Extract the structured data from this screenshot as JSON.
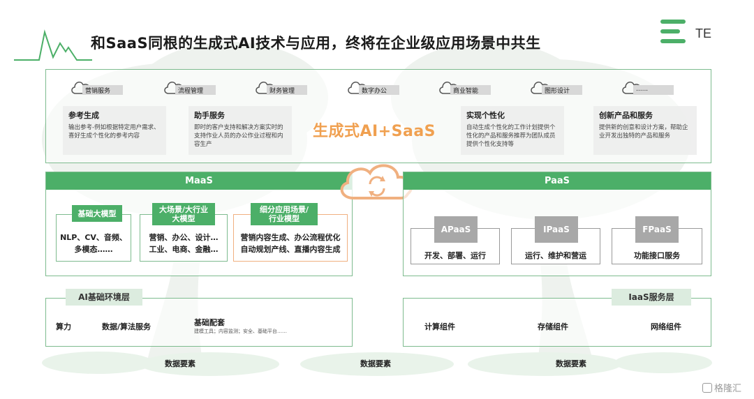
{
  "header": {
    "title": "和SaaS同根的生成式AI技术与应用，终将在企业级应用场景中共生",
    "logo_text": "TE"
  },
  "applications": {
    "categories": [
      "营销服务",
      "流程管理",
      "财务管理",
      "数字办公",
      "商业智能",
      "图形设计",
      "......"
    ],
    "features": [
      {
        "title": "参考生成",
        "desc": "输出参考-例如根据特定用户需求、喜好生成个性化的参考内容"
      },
      {
        "title": "助手服务",
        "desc": "即时的客户支持和解决方案实时的支持作业人员的办公作业过程和内容生产"
      },
      {
        "title": "实现个性化",
        "desc": "自动生成个性化的工作计划提供个性化的产品和服务推荐为团队成员提供个性化支持等"
      },
      {
        "title": "创新产品和服务",
        "desc": "提供新的创意和设计方案，帮助企业开发出独特的产品和服务"
      }
    ],
    "center_label": "生成式AI+SaaS"
  },
  "maas": {
    "title": "MaaS",
    "models": [
      {
        "title": "基础大模型",
        "body": [
          "NLP、CV、音频、",
          "多模态……"
        ]
      },
      {
        "title": "大场景/大行业大模型",
        "body": [
          "营销、办公、设计…",
          "工业、电商、金融…"
        ]
      },
      {
        "title": "细分应用场景/行业模型",
        "body": [
          "营销内容生成、办公流程优化",
          "自动规划产线、直播内容生成"
        ]
      }
    ]
  },
  "paas": {
    "title": "PaaS",
    "items": [
      {
        "title": "APaaS",
        "body": "开发、部署、运行"
      },
      {
        "title": "IPaaS",
        "body": "运行、维护和营运"
      },
      {
        "title": "FPaaS",
        "body": "功能接口服务"
      }
    ]
  },
  "ai_env": {
    "title": "AI基础环境层",
    "items": [
      "算力",
      "数据/算法服务",
      "基础配套"
    ],
    "sub": "建模工具；内容监测；安全、基础平台……"
  },
  "iaas": {
    "title": "IaaS服务层",
    "items": [
      "计算组件",
      "存储组件",
      "网络组件"
    ]
  },
  "ground": {
    "labels": [
      "数据要素",
      "数据要素",
      "数据要素"
    ]
  },
  "watermark": "格隆汇",
  "colors": {
    "green": "#4caf68",
    "light_green": "#7dbb8e",
    "orange": "#f0a050",
    "gray": "#a8a8a8"
  }
}
